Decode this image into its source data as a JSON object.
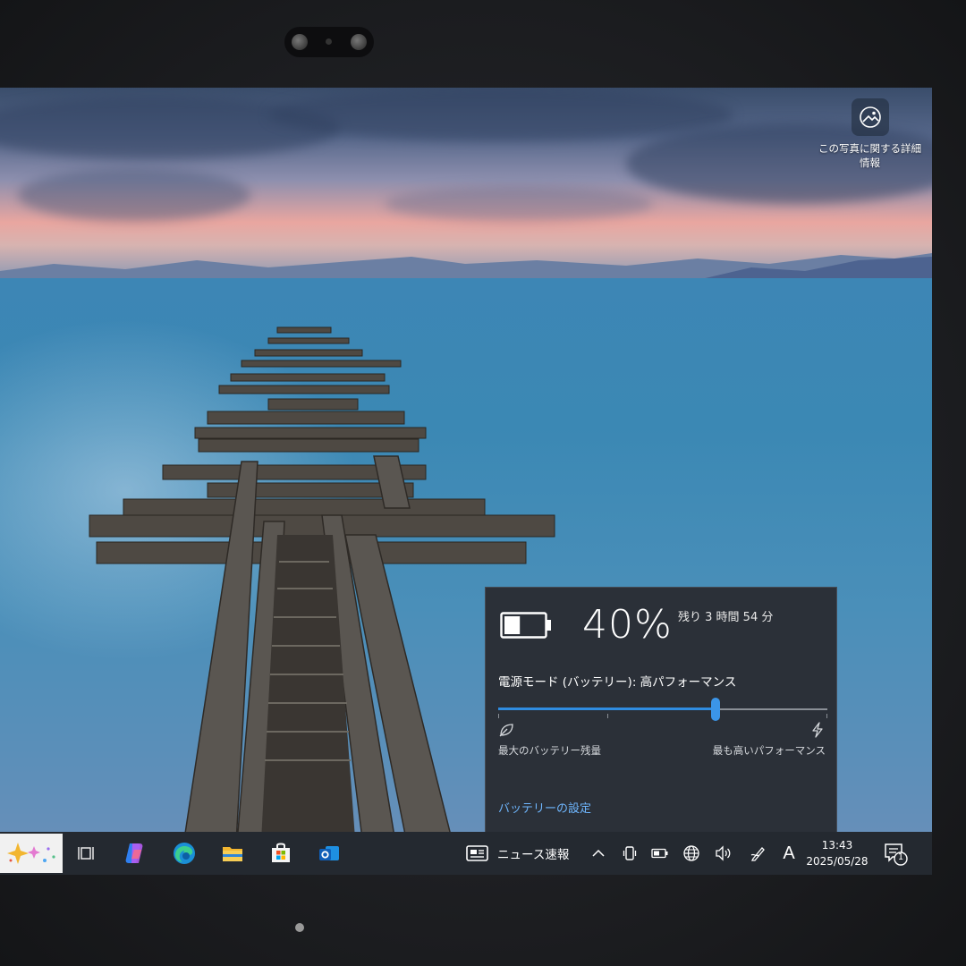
{
  "photo_info": {
    "label": "この写真に関する詳細情報",
    "icon": "image-info-icon"
  },
  "battery": {
    "percent_text": "40%",
    "level": 0.4,
    "remaining": "残り 3 時間 54 分",
    "power_mode": "電源モード (バッテリー): 高パフォーマンス",
    "slider_level": 0.66,
    "slider_left_label": "最大のバッテリー残量",
    "slider_right_label": "最も高いパフォーマンス",
    "settings_link": "バッテリーの設定",
    "accent": "#3b95e8"
  },
  "taskbar": {
    "apps": [
      {
        "name": "copilot-sparkle-icon"
      },
      {
        "name": "task-view-icon"
      },
      {
        "name": "copilot-app-icon"
      },
      {
        "name": "edge-icon"
      },
      {
        "name": "file-explorer-icon"
      },
      {
        "name": "microsoft-store-icon"
      },
      {
        "name": "outlook-icon"
      }
    ],
    "news_label": "ニュース速報",
    "ime_label": "A",
    "time": "13:43",
    "date": "2025/05/28",
    "notification_count": "1"
  }
}
